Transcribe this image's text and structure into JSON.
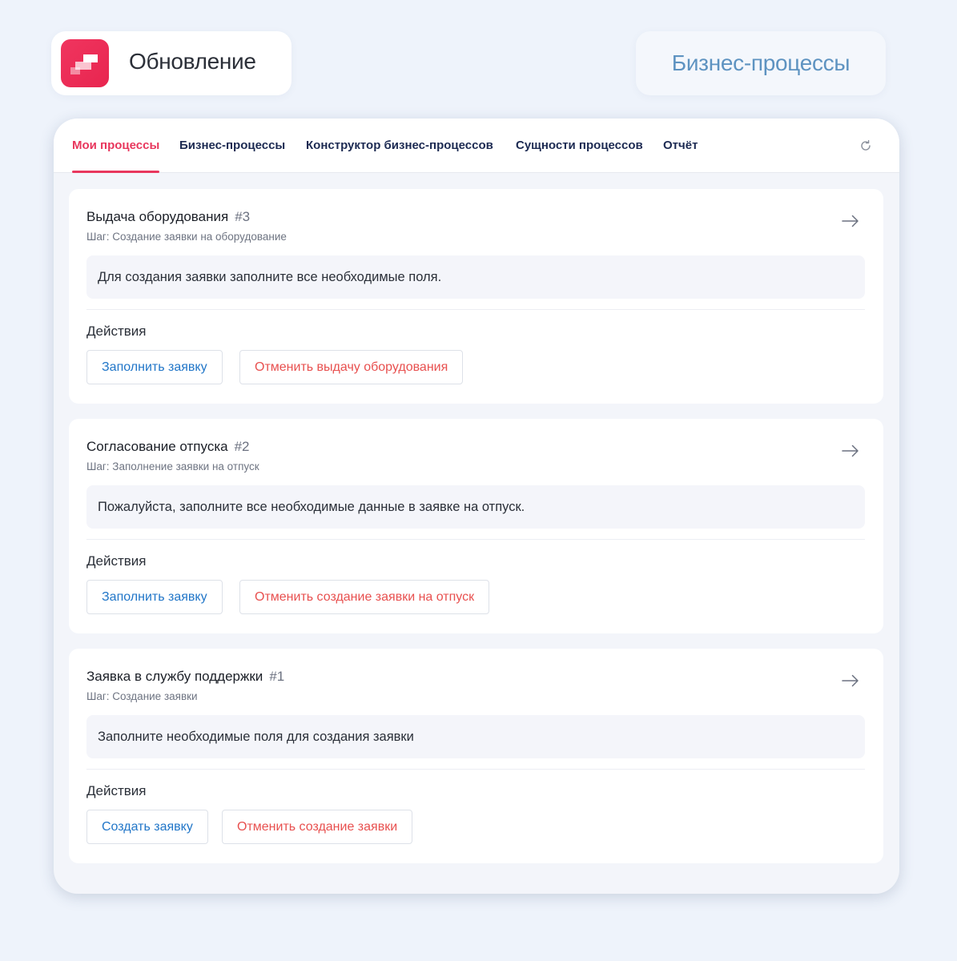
{
  "header": {
    "product_title": "Обновление",
    "section_title": "Бизнес-процессы"
  },
  "tabs": [
    {
      "label": "Мои процессы",
      "active": true
    },
    {
      "label": "Бизнес-процессы",
      "active": false
    },
    {
      "label": "Конструктор бизнес-процессов",
      "active": false
    },
    {
      "label": "Сущности процессов",
      "active": false
    },
    {
      "label": "Отчёт",
      "active": false
    }
  ],
  "processes": [
    {
      "title": "Выдача оборудования",
      "number": "#3",
      "step": "Шаг: Создание заявки на оборудование",
      "message": "Для создания заявки заполните все необходимые поля.",
      "actions_label": "Действия",
      "primary_action": "Заполнить заявку",
      "cancel_action": "Отменить выдачу оборудования"
    },
    {
      "title": "Согласование отпуска",
      "number": "#2",
      "step": "Шаг: Заполнение заявки на отпуск",
      "message": "Пожалуйста, заполните все необходимые данные в заявке на отпуск.",
      "actions_label": "Действия",
      "primary_action": "Заполнить заявку",
      "cancel_action": "Отменить создание заявки на отпуск"
    },
    {
      "title": "Заявка в службу поддержки",
      "number": "#1",
      "step": "Шаг: Создание заявки",
      "message": "Заполните необходимые поля для создания заявки",
      "actions_label": "Действия",
      "primary_action": "Создать заявку",
      "cancel_action": "Отменить создание заявки"
    }
  ],
  "colors": {
    "accent": "#e8375d",
    "primary_action": "#2176c8",
    "cancel_action": "#e8504f",
    "section_title": "#5e93c1"
  },
  "icons": [
    "app-logo-icon",
    "refresh-icon",
    "arrow-right-icon"
  ]
}
